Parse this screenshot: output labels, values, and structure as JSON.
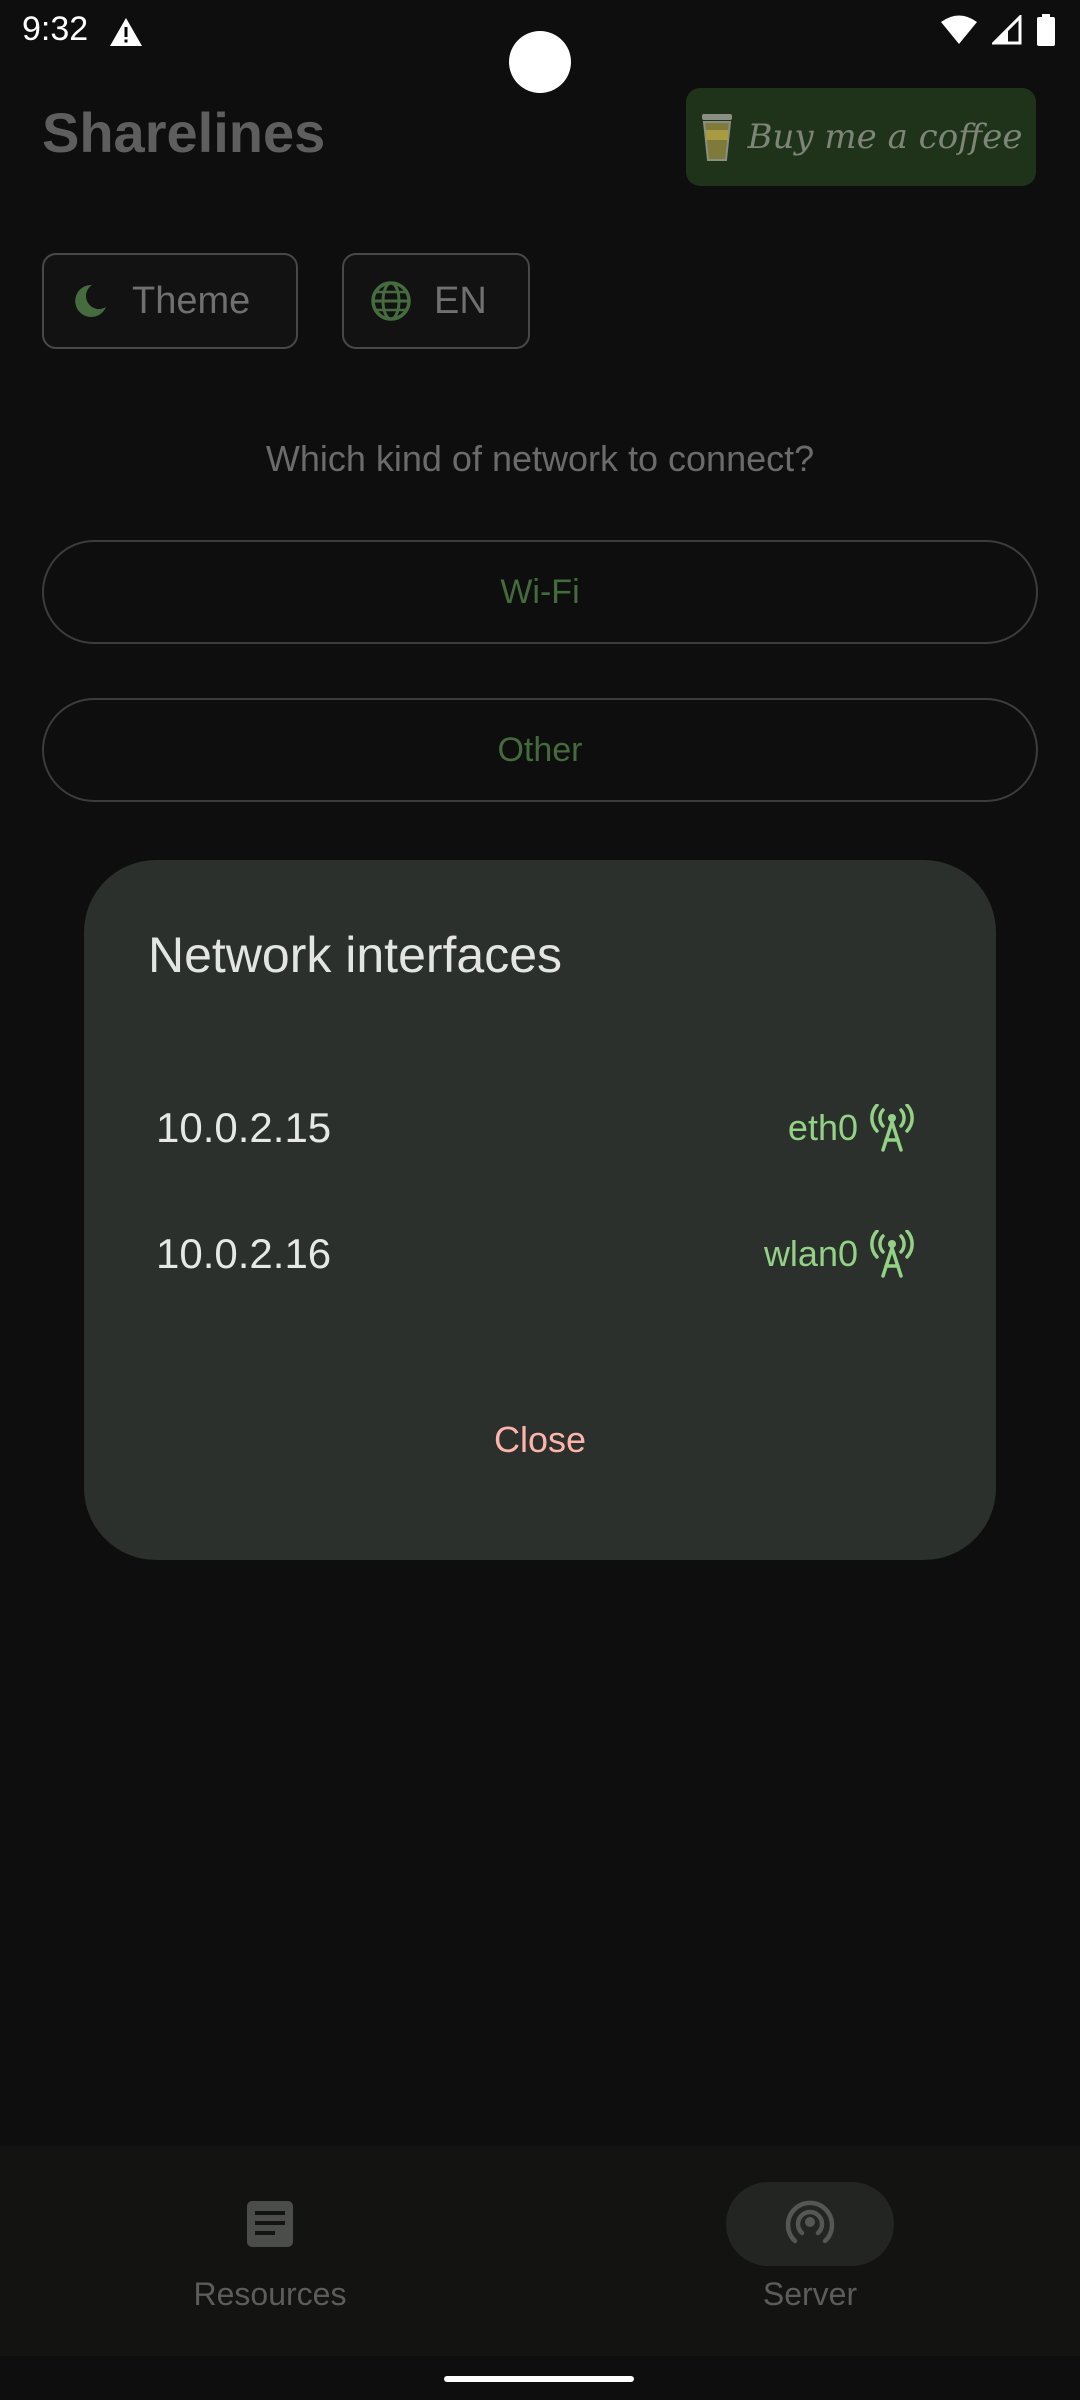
{
  "status_bar": {
    "time": "9:32",
    "alert_icon": "warning-icon",
    "icons": [
      "wifi-icon",
      "signal-icon",
      "battery-icon"
    ]
  },
  "header": {
    "title": "Sharelines",
    "coffee_label": "Buy me a coffee",
    "coffee_icon": "coffee-cup-icon"
  },
  "chips": {
    "theme_label": "Theme",
    "theme_icon": "moon-icon",
    "language_label": "EN",
    "language_icon": "globe-icon"
  },
  "main": {
    "question": "Which kind of network to connect?",
    "wifi_label": "Wi-Fi",
    "other_label": "Other"
  },
  "dialog": {
    "title": "Network interfaces",
    "interfaces": [
      {
        "ip": "10.0.2.15",
        "name": "eth0",
        "icon": "antenna-icon"
      },
      {
        "ip": "10.0.2.16",
        "name": "wlan0",
        "icon": "antenna-icon"
      }
    ],
    "close_label": "Close"
  },
  "bottom_nav": {
    "items": [
      {
        "label": "Resources",
        "icon": "article-icon",
        "selected": false
      },
      {
        "label": "Server",
        "icon": "podcast-icon",
        "selected": true
      }
    ]
  },
  "colors": {
    "background": "#0d0e0d",
    "dialog_surface": "#2b302c",
    "accent_green": "#93d185",
    "close_red": "#ffb4ab"
  }
}
